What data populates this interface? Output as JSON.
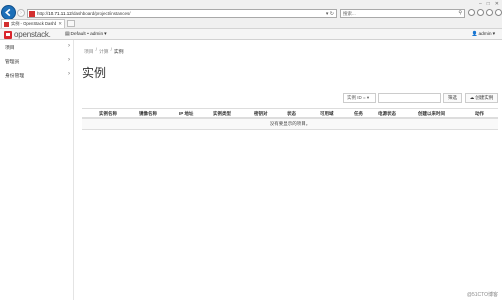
{
  "window": {
    "min": "–",
    "max": "□",
    "close": "✕"
  },
  "browser": {
    "url_prefix": "http://",
    "url_host": "10.71.11.12",
    "url_path": "/dashboard/project/instances/",
    "addr_tools": "▾ ↻",
    "search_placeholder": "搜索...",
    "search_icon": "magnifier-icon",
    "tab_title": "实例 - OpenStack Dashb...",
    "tab_close": "✕"
  },
  "header": {
    "logo_text": "openstack.",
    "project_label": "Default • admin",
    "user_label": "admin"
  },
  "sidebar": {
    "items": [
      {
        "label": "项目",
        "chevron": "›"
      },
      {
        "label": "管理员",
        "chevron": "›"
      },
      {
        "label": "身份管理",
        "chevron": "›"
      }
    ]
  },
  "breadcrumb": {
    "items": [
      "项目",
      "计算",
      "实例"
    ],
    "separator": "/"
  },
  "page": {
    "title": "实例"
  },
  "toolbar": {
    "filter_field": "实例 ID = ▾",
    "filter_button": "筛选",
    "create_button": "创建实例",
    "create_icon": "cloud-upload-icon"
  },
  "table": {
    "columns": [
      "实例名称",
      "镜像名称",
      "IP 地址",
      "实例类型",
      "密钥对",
      "状态",
      "可用域",
      "任务",
      "电源状态",
      "创建以来时间",
      "动作"
    ],
    "empty_message": "没有要显示的项目。"
  },
  "watermark": "@51CTO博客"
}
